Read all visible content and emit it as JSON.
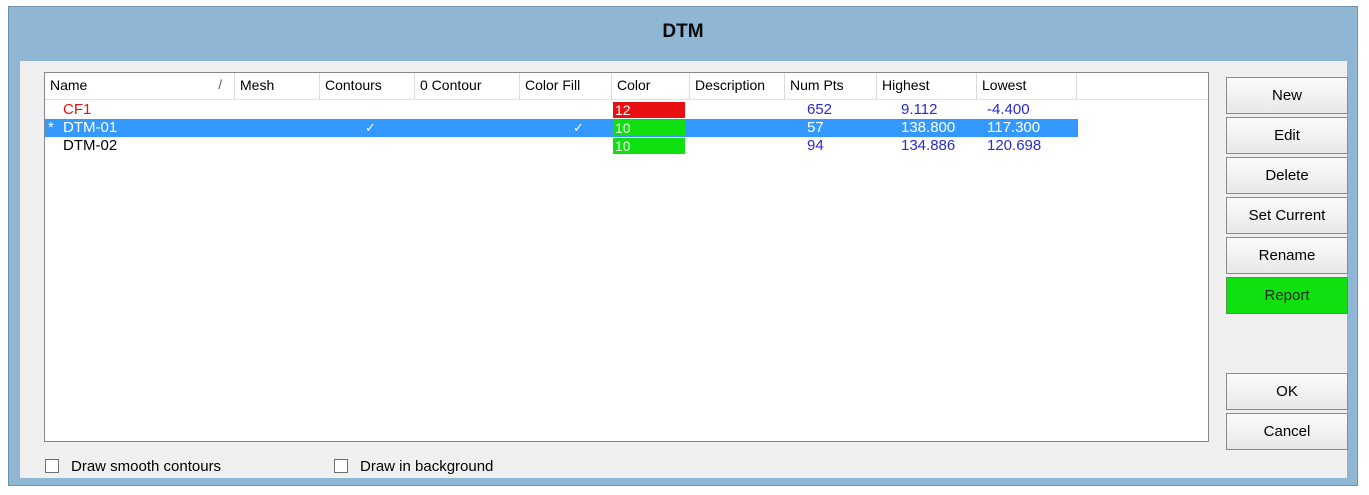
{
  "window": {
    "title": "DTM"
  },
  "columns": [
    {
      "label": "Name"
    },
    {
      "label": "Mesh"
    },
    {
      "label": "Contours"
    },
    {
      "label": "0 Contour"
    },
    {
      "label": "Color Fill"
    },
    {
      "label": "Color"
    },
    {
      "label": "Description"
    },
    {
      "label": "Num Pts"
    },
    {
      "label": "Highest"
    },
    {
      "label": "Lowest"
    }
  ],
  "sort_indicator": "/",
  "rows": [
    {
      "name": "CF1",
      "marker": "",
      "contours": "",
      "color_fill": "",
      "color_index": "12",
      "color_hex": "#e81010",
      "num_pts": "652",
      "highest": "9.112",
      "lowest": "-4.400",
      "selected": false,
      "name_color": "red"
    },
    {
      "name": "DTM-01",
      "marker": "*",
      "contours": "✓",
      "color_fill": "✓",
      "color_index": "10",
      "color_hex": "#10e010",
      "num_pts": "57",
      "highest": "138.800",
      "lowest": "117.300",
      "selected": true,
      "name_color": "white"
    },
    {
      "name": "DTM-02",
      "marker": "",
      "contours": "",
      "color_fill": "",
      "color_index": "10",
      "color_hex": "#10e010",
      "num_pts": "94",
      "highest": "134.886",
      "lowest": "120.698",
      "selected": false,
      "name_color": "black"
    }
  ],
  "buttons": {
    "new": "New",
    "edit": "Edit",
    "delete": "Delete",
    "set_current": "Set Current",
    "rename": "Rename",
    "report": "Report",
    "ok": "OK",
    "cancel": "Cancel"
  },
  "options": {
    "smooth_contours": {
      "label": "Draw smooth contours",
      "checked": false
    },
    "draw_background": {
      "label": "Draw in background",
      "checked": false
    }
  },
  "colors": {
    "title_bar": "#8fb6d2",
    "selection": "#3399ff",
    "report_button": "#10e010",
    "numeric_text": "#2a2ad0"
  }
}
